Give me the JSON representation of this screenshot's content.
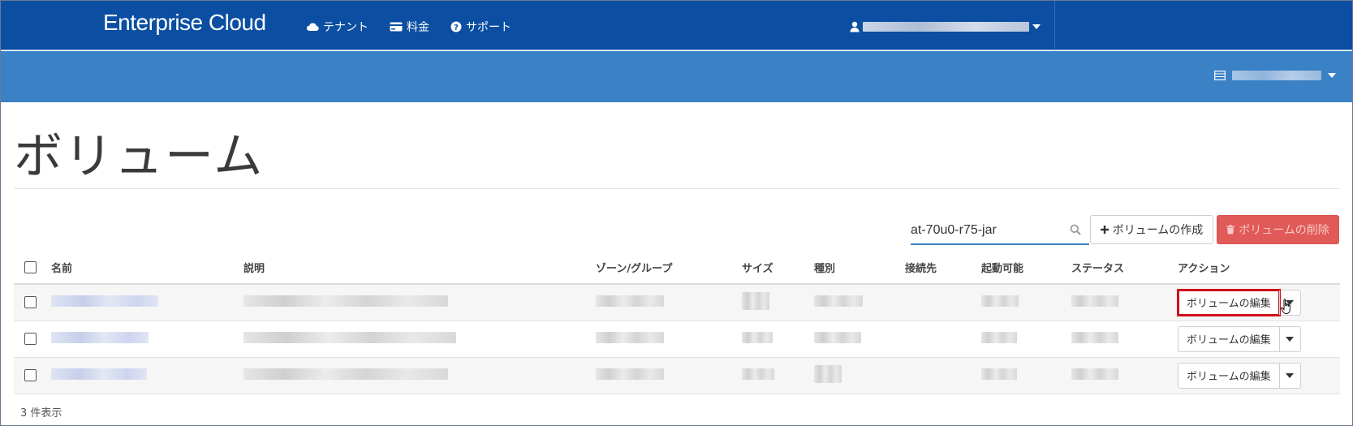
{
  "header": {
    "brand": "Enterprise Cloud",
    "nav": [
      {
        "label": "テナント",
        "icon": "cloud-icon"
      },
      {
        "label": "料金",
        "icon": "credit-card-icon"
      },
      {
        "label": "サポート",
        "icon": "question-circle-icon"
      }
    ],
    "user_icon": "user-icon"
  },
  "subbar": {
    "project_icon": "server-icon"
  },
  "page": {
    "title": "ボリューム"
  },
  "toolbar": {
    "search_value": "at-70u0-r75-jar",
    "create_label": "ボリュームの作成",
    "delete_label": "ボリュームの削除"
  },
  "table": {
    "columns": [
      "名前",
      "説明",
      "ゾーン/グループ",
      "サイズ",
      "種別",
      "接続先",
      "起動可能",
      "ステータス",
      "アクション"
    ],
    "rows": [
      {
        "action_label": "ボリュームの編集"
      },
      {
        "action_label": "ボリュームの編集"
      },
      {
        "action_label": "ボリュームの編集"
      }
    ]
  },
  "footer": {
    "count_text": "3 件表示"
  },
  "colors": {
    "header_bg": "#0b4ea2",
    "subbar_bg": "#3a81c6",
    "delete_btn": "#e05a57",
    "highlight": "#d0101b"
  }
}
